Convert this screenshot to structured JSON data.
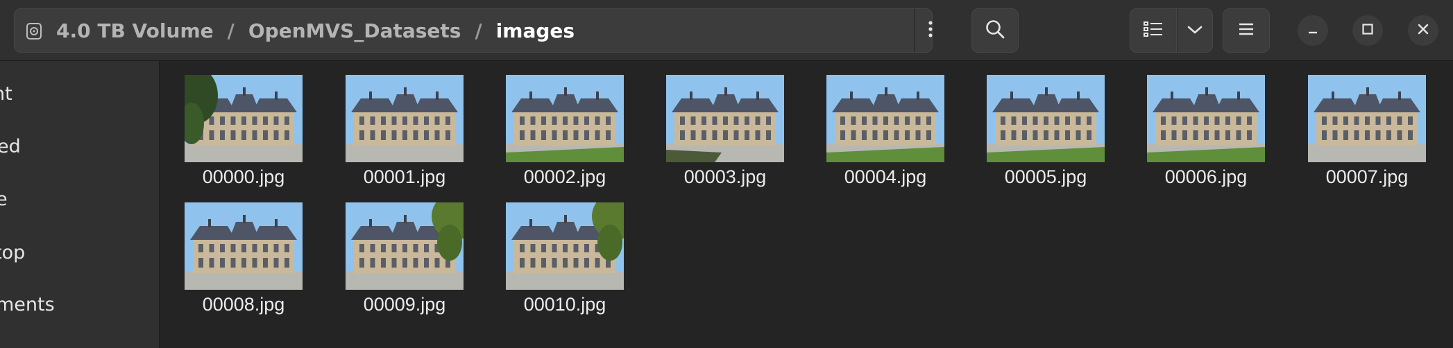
{
  "header": {
    "breadcrumbs": [
      "4.0 TB Volume",
      "OpenMVS_Datasets",
      "images"
    ],
    "separator": "/",
    "drive_icon": "drive-icon",
    "menu_icon": "vertical-dots-icon",
    "search_icon": "search-icon",
    "view_icon": "list-view-icon",
    "view_dropdown_icon": "chevron-down-icon",
    "main_menu_icon": "hamburger-menu-icon",
    "window_controls": [
      "minimize-icon",
      "maximize-icon",
      "close-icon"
    ]
  },
  "sidebar": {
    "items": [
      {
        "label": "nt"
      },
      {
        "label": "ed"
      },
      {
        "label": "e"
      },
      {
        "label": "top"
      },
      {
        "label": "ments"
      }
    ]
  },
  "files": [
    {
      "name": "00000.jpg",
      "variant": "tree-left"
    },
    {
      "name": "00001.jpg",
      "variant": "plain"
    },
    {
      "name": "00002.jpg",
      "variant": "lawn"
    },
    {
      "name": "00003.jpg",
      "variant": "shadow"
    },
    {
      "name": "00004.jpg",
      "variant": "lawn"
    },
    {
      "name": "00005.jpg",
      "variant": "lawn"
    },
    {
      "name": "00006.jpg",
      "variant": "lawn"
    },
    {
      "name": "00007.jpg",
      "variant": "plain"
    },
    {
      "name": "00008.jpg",
      "variant": "plain"
    },
    {
      "name": "00009.jpg",
      "variant": "tree-right"
    },
    {
      "name": "00010.jpg",
      "variant": "tree-right"
    }
  ],
  "colors": {
    "window_bg": "#242424",
    "header_bg": "#303030",
    "sky": "#8fc3ee",
    "stone": "#c9b99a",
    "roof": "#4e5566",
    "lawn": "#5f8f3a",
    "ground": "#b8b8b3"
  }
}
